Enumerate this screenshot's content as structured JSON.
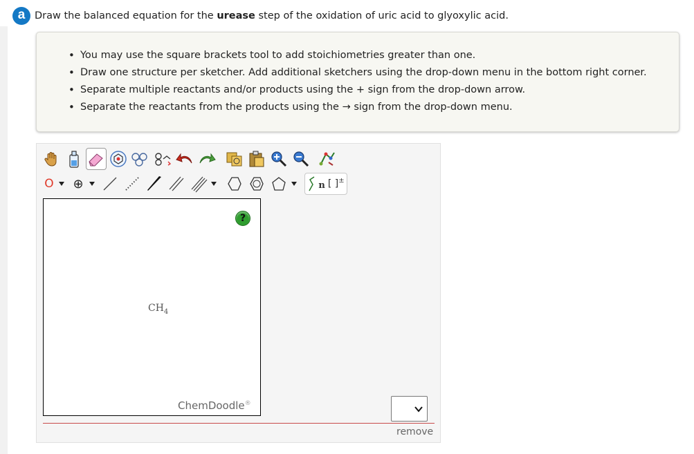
{
  "question": {
    "badge": "a",
    "text_before": "Draw the balanced equation for the ",
    "text_bold": "urease",
    "text_after": " step of the oxidation of uric acid to glyoxylic acid."
  },
  "instructions": [
    "You may use the square brackets tool to add stoichiometries greater than one.",
    "Draw one structure per sketcher. Add additional sketchers using the drop-down menu in the bottom right corner.",
    "Separate multiple reactants and/or products using the + sign from the drop-down arrow.",
    "Separate the reactants from the products using the → sign from the drop-down menu."
  ],
  "toolbar": {
    "row1": [
      "hand-tool",
      "erase-bottle",
      "lasso-eraser",
      "ring-templates",
      "chain-template",
      "undo",
      "redo",
      "copy",
      "paste",
      "zoom-in",
      "zoom-out",
      "clean-structure"
    ],
    "row2": {
      "atom_label": "O",
      "charge_label": "⊕",
      "bond_tools": [
        "single-bond",
        "dashed-bond",
        "wedge-bond",
        "double-bond",
        "triple-bond"
      ],
      "ring_tools": [
        "cyclopropane-ring",
        "benzene-ring",
        "cyclopentane-ring"
      ],
      "repeat_label": "n",
      "brackets_label": "[ ]",
      "bracket_charge": "±"
    }
  },
  "canvas": {
    "help": "?",
    "molecule": "CH",
    "molecule_sub": "4",
    "brand": "ChemDoodle",
    "brand_mark": "®"
  },
  "footer": {
    "remove_label": "remove"
  }
}
